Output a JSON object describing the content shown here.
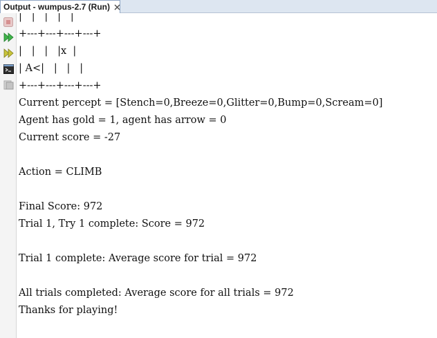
{
  "tab": {
    "title": "Output - wumpus-2.7 (Run)"
  },
  "toolbar": {
    "icons": [
      "stop-icon",
      "rerun-icon",
      "rerun-with-options-icon",
      "console-icon",
      "clear-output-icon"
    ]
  },
  "console": {
    "lines": [
      "|   |   |   |   |",
      "+---+---+---+---+",
      "|   |   |   |x  |",
      "| A<|   |   |   |",
      "+---+---+---+---+",
      "Current percept = [Stench=0,Breeze=0,Glitter=0,Bump=0,Scream=0]",
      "Agent has gold = 1, agent has arrow = 0",
      "Current score = -27",
      "",
      "Action = CLIMB",
      "",
      "Final Score: 972",
      "Trial 1, Try 1 complete: Score = 972",
      "",
      "Trial 1 complete: Average score for trial = 972",
      "",
      "All trials completed: Average score for all trials = 972",
      "Thanks for playing!"
    ]
  }
}
